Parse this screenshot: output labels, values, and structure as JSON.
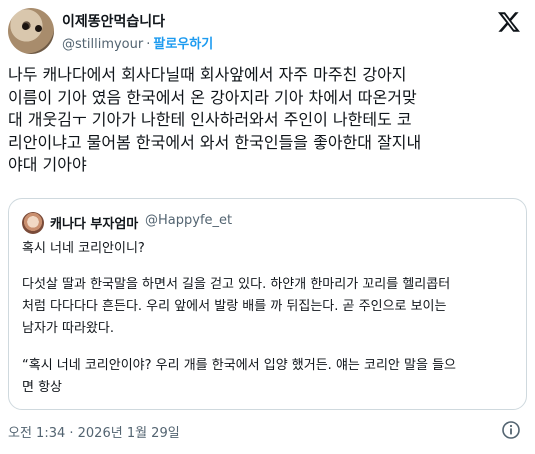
{
  "author": {
    "name": "이제똥안먹습니다",
    "handle": "@stillimyour",
    "separator": "·",
    "follow_label": "팔로우하기"
  },
  "tweet": {
    "lines": [
      "나두 캐나다에서 회사다닐때 회사앞에서 자주 마주친 강아지",
      "이름이 기아 였음 한국에서 온 강아지라 기아 차에서 따온거맞",
      "대 개웃김ㅜ 기아가 나한테 인사하러와서 주인이 나한테도 코",
      "리안이냐고 물어봄 한국에서 와서 한국인들을 좋아한대 잘지내",
      "야대 기아야"
    ]
  },
  "quote": {
    "name": "캐나다 부자엄마",
    "handle": "@Happyfe_et",
    "lines": [
      "혹시 너네 코리안이니?",
      "다섯살 딸과 한국말을 하면서 길을 걷고 있다. 하얀개 한마리가 꼬리를 헬리콥터",
      "처럼 다다다다 흔든다. 우리 앞에서 발랑 배를 까 뒤집는다. 곧 주인으로 보이는",
      "남자가 따라왔다.",
      "“혹시 너네 코리안이야? 우리 개를 한국에서 입양 했거든. 얘는 코리안 말을 들으",
      "면 항상"
    ]
  },
  "footer": {
    "timestamp": "오전 1:34 · 2026년 1월 29일"
  },
  "icons": {
    "logo": "x-logo-icon",
    "info": "info-icon"
  },
  "colors": {
    "link": "#1d9bf0",
    "secondary_text": "#536471",
    "border": "#cfd9de"
  }
}
